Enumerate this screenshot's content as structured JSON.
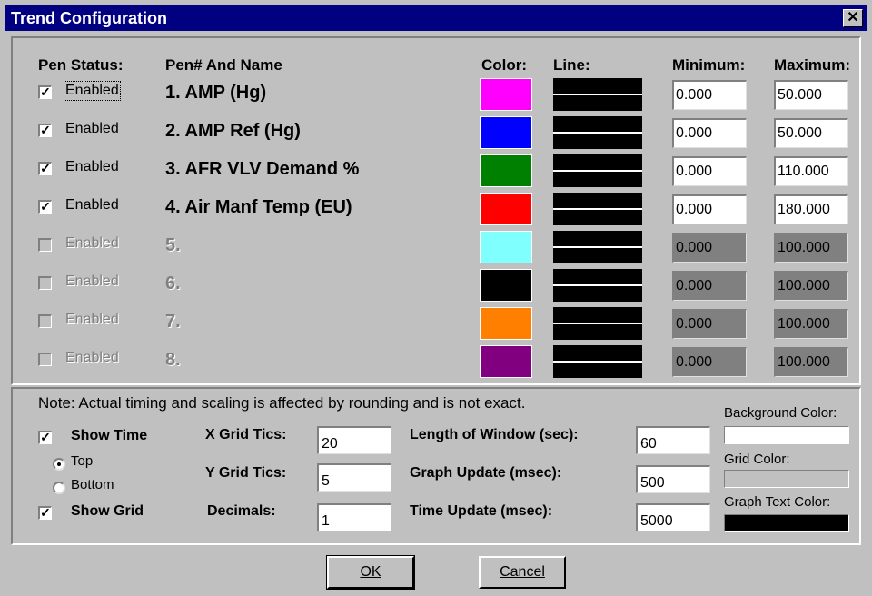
{
  "window": {
    "title": "Trend Configuration",
    "close_glyph": "✕"
  },
  "headers": {
    "pen_status": "Pen Status:",
    "pen_name": "Pen# And Name",
    "color": "Color:",
    "line": "Line:",
    "minimum": "Minimum:",
    "maximum": "Maximum:"
  },
  "pens": [
    {
      "enabled": true,
      "label": "Enabled",
      "name": "1. AMP (Hg)",
      "color": "#ff00ff",
      "min": "0.000",
      "max": "50.000"
    },
    {
      "enabled": true,
      "label": "Enabled",
      "name": "2. AMP Ref (Hg)",
      "color": "#0000ff",
      "min": "0.000",
      "max": "50.000"
    },
    {
      "enabled": true,
      "label": "Enabled",
      "name": "3. AFR VLV Demand %",
      "color": "#008000",
      "min": "0.000",
      "max": "110.000"
    },
    {
      "enabled": true,
      "label": "Enabled",
      "name": "4. Air Manf Temp (EU)",
      "color": "#ff0000",
      "min": "0.000",
      "max": "180.000"
    },
    {
      "enabled": false,
      "label": "Enabled",
      "name": "5.",
      "color": "#80ffff",
      "min": "0.000",
      "max": "100.000"
    },
    {
      "enabled": false,
      "label": "Enabled",
      "name": "6.",
      "color": "#000000",
      "min": "0.000",
      "max": "100.000"
    },
    {
      "enabled": false,
      "label": "Enabled",
      "name": "7.",
      "color": "#ff8000",
      "min": "0.000",
      "max": "100.000"
    },
    {
      "enabled": false,
      "label": "Enabled",
      "name": "8.",
      "color": "#800080",
      "min": "0.000",
      "max": "100.000"
    }
  ],
  "note": "Note: Actual timing and scaling is affected by rounding and is not exact.",
  "options": {
    "show_time": {
      "label": "Show Time",
      "checked": true
    },
    "top": {
      "label": "Top",
      "selected": true
    },
    "bottom": {
      "label": "Bottom",
      "selected": false
    },
    "show_grid": {
      "label": "Show Grid",
      "checked": true
    },
    "x_grid_tics": {
      "label": "X Grid Tics:",
      "value": "20"
    },
    "y_grid_tics": {
      "label": "Y Grid Tics:",
      "value": "5"
    },
    "decimals": {
      "label": "Decimals:",
      "value": "1"
    },
    "length_of_window": {
      "label": "Length of Window (sec):",
      "value": "60"
    },
    "graph_update": {
      "label": "Graph Update (msec):",
      "value": "500"
    },
    "time_update": {
      "label": "Time Update (msec):",
      "value": "5000"
    },
    "background_color": {
      "label": "Background Color:",
      "color": "#ffffff"
    },
    "grid_color": {
      "label": "Grid Color:",
      "color": "#c0c0c0"
    },
    "graph_text_color": {
      "label": "Graph Text Color:",
      "color": "#000000"
    }
  },
  "buttons": {
    "ok": "OK",
    "cancel": "Cancel"
  },
  "check_glyph": "✓"
}
